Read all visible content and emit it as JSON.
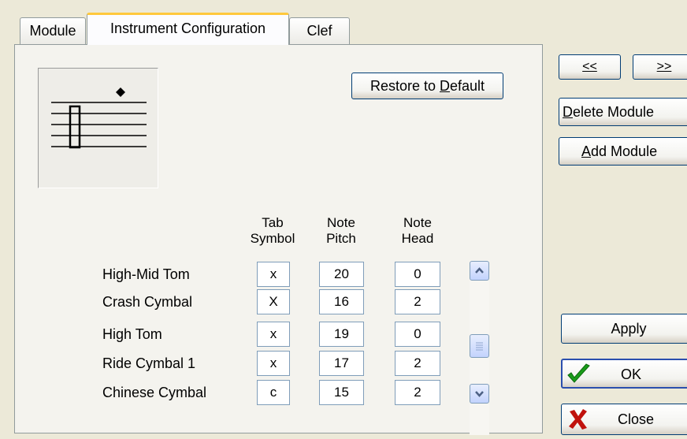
{
  "tabs": [
    {
      "label": "Module"
    },
    {
      "label": "Instrument Configuration"
    },
    {
      "label": "Clef"
    }
  ],
  "buttons": {
    "restore_prefix": "Restore to ",
    "restore_underlined": "D",
    "restore_suffix": "efault",
    "prev_label": "<<",
    "next_label": ">>",
    "delete_underlined": "D",
    "delete_rest": "elete Module",
    "add_underlined": "A",
    "add_rest": "dd Module",
    "apply_label": "Apply",
    "ok_label": "OK",
    "close_label": "Close"
  },
  "columns": {
    "tab_symbol": "Tab\nSymbol",
    "note_pitch": "Note\nPitch",
    "note_head": "Note\nHead"
  },
  "rows": [
    {
      "name": "High-Mid Tom",
      "tab": "x",
      "pitch": "20",
      "head": "0"
    },
    {
      "name": "Crash Cymbal",
      "tab": "X",
      "pitch": "16",
      "head": "2"
    },
    {
      "name": "High Tom",
      "tab": "x",
      "pitch": "19",
      "head": "0"
    },
    {
      "name": "Ride Cymbal 1",
      "tab": "x",
      "pitch": "17",
      "head": "2"
    },
    {
      "name": "Chinese Cymbal",
      "tab": "c",
      "pitch": "15",
      "head": "2"
    }
  ],
  "colors": {
    "ok_check": "#1a9c1a",
    "close_x": "#c0120c",
    "active_tab_accent": "#ffc83c"
  }
}
